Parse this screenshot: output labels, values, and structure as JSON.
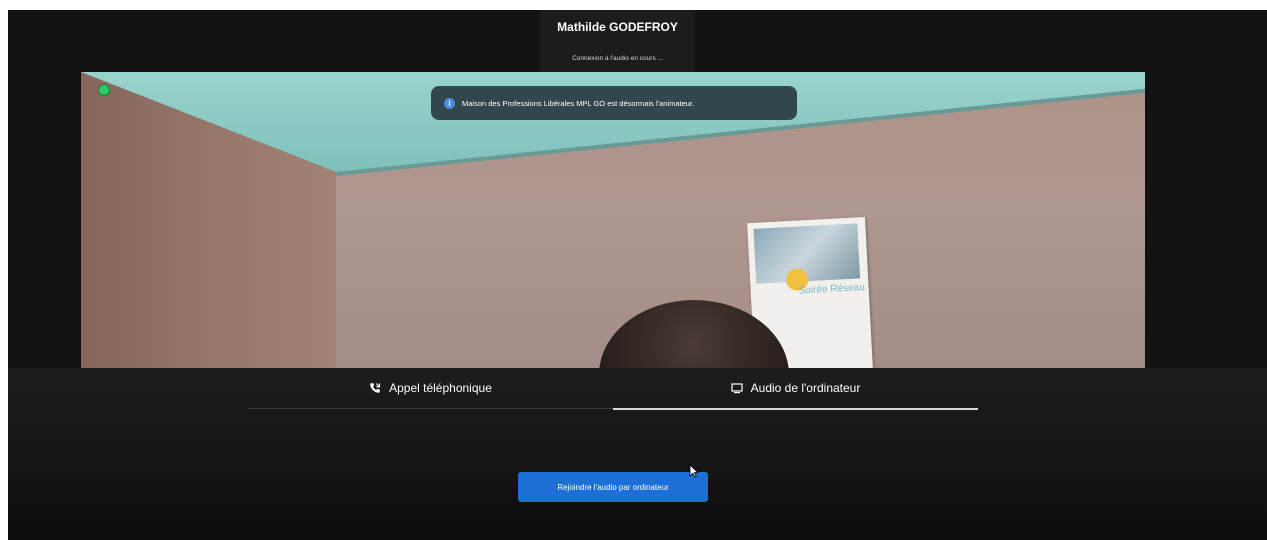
{
  "header": {
    "participant_name": "Mathilde GODEFROY",
    "audio_status": "Connexion à l'audio en cours ..."
  },
  "notification": {
    "icon": "info-icon",
    "message": "Maison des Professions Libérales MPL GO est désormais l'animateur."
  },
  "video": {
    "status_indicator_color": "#2ec866",
    "poster_text": "Soirée Réseau"
  },
  "audio_tabs": [
    {
      "label": "Appel téléphonique",
      "icon": "phone-icon",
      "active": false
    },
    {
      "label": "Audio de l'ordinateur",
      "icon": "monitor-icon",
      "active": true
    }
  ],
  "join_button": {
    "label": "Rejoindre l'audio par ordinateur",
    "color": "#1d6fd8"
  }
}
